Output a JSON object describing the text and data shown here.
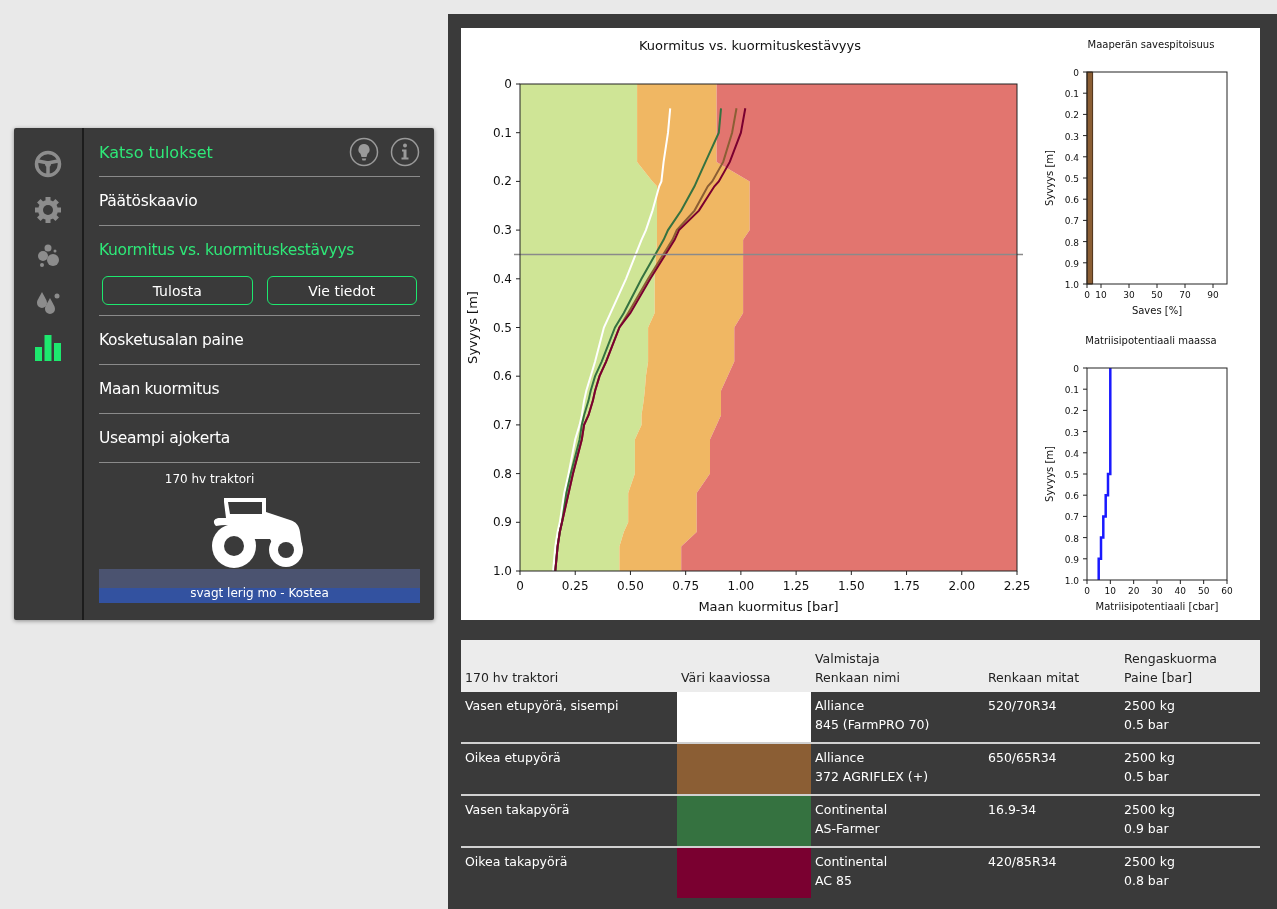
{
  "sidebar": {
    "rail": [
      {
        "selected": false
      },
      {
        "selected": false
      },
      {
        "selected": false
      },
      {
        "selected": false
      },
      {
        "selected": true
      }
    ],
    "heading": "Katso tulokset",
    "items": [
      {
        "label": "Päätöskaavio",
        "selected": false
      },
      {
        "label": "Kuormitus vs. kuormituskestävyys",
        "selected": true,
        "buttons": [
          "Tulosta",
          "Vie tiedot"
        ]
      },
      {
        "label": "Kosketusalan paine",
        "selected": false
      },
      {
        "label": "Maan kuormitus",
        "selected": false
      },
      {
        "label": "Useampi ajokerta",
        "selected": false
      }
    ],
    "vehicle": "170 hv traktori",
    "soil": "svagt lerig mo - Kostea"
  },
  "load_chart": {
    "chart_data": {
      "type": "line",
      "orientation": "horizontal",
      "title": "Kuormitus vs. kuormituskestävyys",
      "xlabel": "Maan kuormitus [bar]",
      "ylabel": "Syvyys [m]",
      "x": [
        0,
        0.05,
        0.1,
        0.16,
        0.2,
        0.21,
        0.26,
        0.3,
        0.32,
        0.4,
        0.47,
        0.5,
        0.57,
        0.6,
        0.63,
        0.65,
        0.68,
        0.7,
        0.73,
        0.8,
        0.84,
        0.9,
        0.92,
        0.95,
        1.0
      ],
      "series": [
        {
          "type": "area",
          "color": "#cfe596",
          "values": [
            0.53,
            0.53,
            0.53,
            0.53,
            0.6,
            0.62,
            0.62,
            0.62,
            0.62,
            0.61,
            0.61,
            0.58,
            0.58,
            0.57,
            0.565,
            0.56,
            0.55,
            0.55,
            0.52,
            0.52,
            0.49,
            0.49,
            0.47,
            0.45,
            0.45
          ]
        },
        {
          "type": "area",
          "color": "#f0b763",
          "values": [
            0.36,
            0.36,
            0.36,
            0.36,
            0.44,
            0.42,
            0.42,
            0.42,
            0.39,
            0.4,
            0.4,
            0.39,
            0.39,
            0.37,
            0.345,
            0.35,
            0.36,
            0.34,
            0.34,
            0.34,
            0.31,
            0.31,
            0.33,
            0.28,
            0.28
          ]
        },
        {
          "type": "area",
          "color": "#e2756f",
          "values": [
            1.36,
            1.36,
            1.36,
            1.36,
            1.21,
            1.21,
            1.21,
            1.21,
            1.24,
            1.24,
            1.24,
            1.28,
            1.28,
            1.31,
            1.34,
            1.34,
            1.34,
            1.36,
            1.39,
            1.39,
            1.45,
            1.45,
            1.45,
            1.52,
            1.52
          ]
        },
        {
          "color": "#ffffff",
          "values": [
            null,
            0.68,
            0.67,
            0.65,
            0.64,
            0.63,
            0.6,
            0.57,
            0.55,
            0.48,
            0.41,
            0.38,
            0.34,
            0.32,
            0.3,
            0.29,
            0.28,
            0.27,
            0.25,
            0.22,
            0.2,
            0.18,
            0.17,
            0.16,
            0.15
          ]
        },
        {
          "color": "#8b5e34",
          "values": [
            null,
            0.98,
            0.96,
            0.92,
            0.87,
            0.85,
            0.79,
            0.71,
            0.69,
            0.58,
            0.49,
            0.45,
            0.39,
            0.36,
            0.34,
            0.33,
            0.31,
            0.29,
            0.28,
            0.24,
            0.22,
            0.19,
            0.18,
            0.17,
            0.16
          ]
        },
        {
          "color": "#357240",
          "values": [
            null,
            0.91,
            0.9,
            0.84,
            0.8,
            0.79,
            0.73,
            0.67,
            0.65,
            0.55,
            0.47,
            0.43,
            0.37,
            0.34,
            0.32,
            0.31,
            0.29,
            0.28,
            0.27,
            0.23,
            0.21,
            0.19,
            0.18,
            0.17,
            0.16
          ]
        },
        {
          "color": "#7a0030",
          "values": [
            null,
            1.02,
            1.0,
            0.95,
            0.9,
            0.88,
            0.81,
            0.72,
            0.7,
            0.59,
            0.5,
            0.45,
            0.39,
            0.36,
            0.34,
            0.33,
            0.31,
            0.29,
            0.28,
            0.24,
            0.22,
            0.19,
            0.18,
            0.17,
            0.16
          ]
        }
      ],
      "xlim": [
        0,
        2.25
      ],
      "ylim": [
        1,
        0
      ],
      "xticks": [
        0,
        {
          "value": 0.25,
          "label": "0.25"
        },
        {
          "value": 0.5,
          "label": "0.50"
        },
        {
          "value": 0.75,
          "label": "0.75"
        },
        {
          "value": 1,
          "label": "1.00"
        },
        {
          "value": 1.25,
          "label": "1.25"
        },
        {
          "value": 1.5,
          "label": "1.50"
        },
        {
          "value": 1.75,
          "label": "1.75"
        },
        {
          "value": 2,
          "label": "2.00"
        },
        {
          "value": 2.25,
          "label": "2.25"
        }
      ],
      "yticks": [
        0,
        0.1,
        0.2,
        0.3,
        0.4,
        0.5,
        0.6,
        0.7,
        0.8,
        0.9,
        {
          "value": 1,
          "label": "1.0"
        }
      ],
      "stacked": true,
      "ref_lines": [
        {
          "axis": "y",
          "value": 0.35
        }
      ]
    }
  },
  "clay_chart": {
    "chart_data": {
      "type": "area",
      "orientation": "horizontal",
      "title": "Maaperän savespitoisuus",
      "xlabel": "Saves [%]",
      "ylabel": "Syvyys [m]",
      "x": [
        0,
        1.0
      ],
      "series": [
        {
          "color": "#8b5e34",
          "values": [
            4,
            4
          ]
        }
      ],
      "xlim": [
        0,
        100
      ],
      "ylim": [
        1,
        0
      ],
      "xticks": [
        0,
        10,
        30,
        50,
        70,
        90
      ],
      "yticks": [
        0,
        0.1,
        0.2,
        0.3,
        0.4,
        0.5,
        0.6,
        0.7,
        0.8,
        0.9,
        {
          "value": 1,
          "label": "1.0"
        }
      ]
    }
  },
  "potential_chart": {
    "chart_data": {
      "type": "line",
      "orientation": "horizontal",
      "title": "Matriisipotentiaali maassa",
      "xlabel": "Matriisipotentiaali [cbar]",
      "ylabel": "Syvyys [m]",
      "x": [
        0,
        0.5,
        0.5,
        0.6,
        0.6,
        0.7,
        0.7,
        0.8,
        0.8,
        0.9,
        0.9,
        1.0
      ],
      "series": [
        {
          "color": "#1a1aff",
          "values": [
            10,
            10,
            9,
            9,
            8,
            8,
            7,
            7,
            6,
            6,
            5,
            5
          ]
        }
      ],
      "xlim": [
        0,
        60
      ],
      "ylim": [
        1,
        0
      ],
      "xticks": [
        0,
        10,
        20,
        30,
        40,
        50,
        60
      ],
      "yticks": [
        0,
        0.1,
        0.2,
        0.3,
        0.4,
        0.5,
        0.6,
        0.7,
        0.8,
        0.9,
        {
          "value": 1,
          "label": "1.0"
        }
      ]
    }
  },
  "table": {
    "columns": [
      [
        "170 hv traktori"
      ],
      [
        "Väri kaaviossa"
      ],
      [
        "Valmistaja",
        "Renkaan nimi"
      ],
      [
        "Renkaan mitat"
      ],
      [
        "Rengaskuorma",
        "Paine [bar]"
      ]
    ],
    "rows": [
      {
        "wheel": "Vasen etupyörä, sisempi",
        "color": "#ffffff",
        "maker": "Alliance",
        "tire": "845 (FarmPRO 70)",
        "size": "520/70R34",
        "load": "2500 kg",
        "pressure": "0.5 bar"
      },
      {
        "wheel": "Oikea etupyörä",
        "color": "#8b5e34",
        "maker": "Alliance",
        "tire": "372 AGRIFLEX (+)",
        "size": "650/65R34",
        "load": "2500 kg",
        "pressure": "0.5 bar"
      },
      {
        "wheel": "Vasen takapyörä",
        "color": "#357240",
        "maker": "Continental",
        "tire": "AS-Farmer",
        "size": "16.9-34",
        "load": "2500 kg",
        "pressure": "0.9 bar"
      },
      {
        "wheel": "Oikea takapyörä",
        "color": "#7a0030",
        "maker": "Continental",
        "tire": "AC 85",
        "size": "420/85R34",
        "load": "2500 kg",
        "pressure": "0.8 bar"
      }
    ]
  }
}
